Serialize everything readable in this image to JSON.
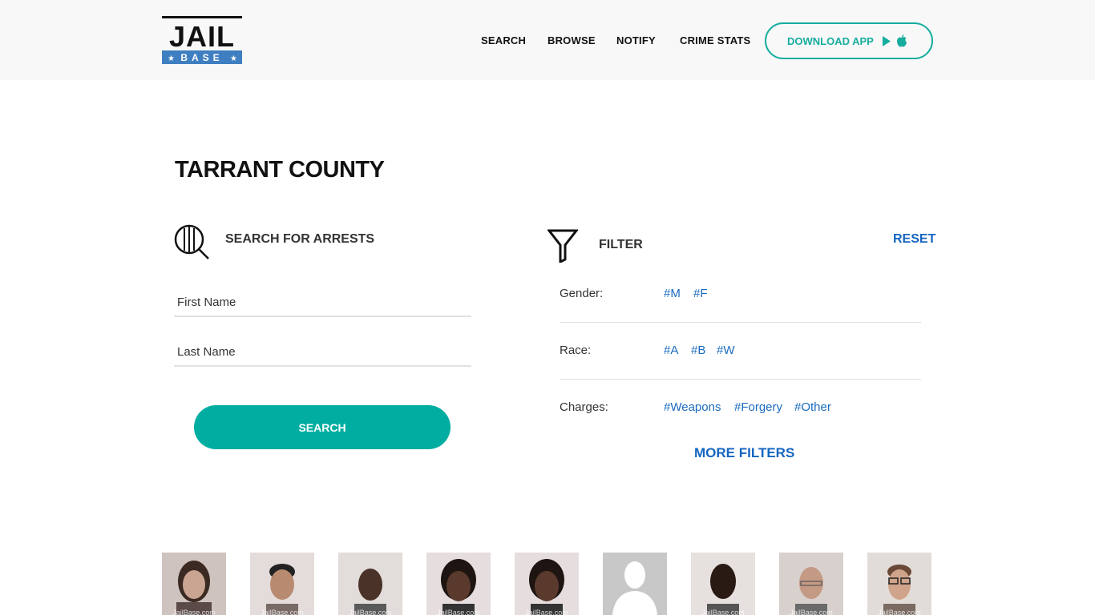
{
  "header": {
    "logo": {
      "top": "JAIL",
      "bottom": "BASE"
    },
    "nav": [
      "SEARCH",
      "BROWSE",
      "NOTIFY",
      "CRIME STATS"
    ],
    "download_label": "DOWNLOAD APP",
    "download_icons": [
      "play-store-icon",
      "apple-icon"
    ]
  },
  "page_title": "TARRANT COUNTY",
  "search": {
    "heading": "SEARCH FOR ARRESTS",
    "first_name_placeholder": "First Name",
    "last_name_placeholder": "Last Name",
    "button_label": "SEARCH"
  },
  "filter": {
    "heading": "FILTER",
    "reset_label": "RESET",
    "groups": [
      {
        "label": "Gender:",
        "tags": [
          "#M",
          "#F"
        ]
      },
      {
        "label": "Race:",
        "tags": [
          "#A",
          "#B",
          "#W"
        ]
      },
      {
        "label": "Charges:",
        "tags": [
          "#Weapons",
          "#Forgery",
          "#Other"
        ]
      }
    ],
    "more_label": "MORE FILTERS"
  },
  "mugshots": {
    "watermark": "JailBase.com",
    "count": 9
  },
  "colors": {
    "accent": "#00ada0",
    "link": "#1565c0",
    "logo_blue": "#3f7fc1"
  }
}
